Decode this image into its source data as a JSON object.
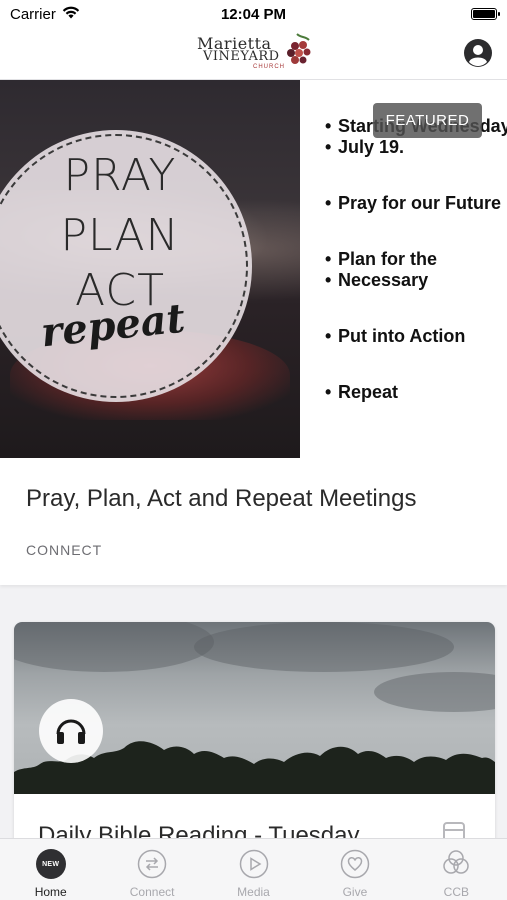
{
  "status_bar": {
    "carrier": "Carrier",
    "time": "12:04 PM"
  },
  "header": {
    "logo_line1": "Marietta",
    "logo_line2": "VINEYARD",
    "logo_line3": "CHURCH",
    "profile_icon": "user-circle-icon"
  },
  "featured": {
    "tag": "FEATURED",
    "image_text": {
      "line1": "PRAY",
      "line2": "PLAN",
      "line3": "ACT",
      "line4": "repeat"
    },
    "bullets": [
      "Starting Wednesday",
      "July 19.",
      "Pray for our Future",
      "Plan for the",
      "Necessary",
      "Put into Action",
      "Repeat"
    ],
    "title": "Pray, Plan, Act and Repeat Meetings",
    "category": "CONNECT"
  },
  "media_card": {
    "icon": "headphones-icon",
    "title": "Daily Bible Reading - Tuesday",
    "side_icon": "document-icon"
  },
  "tab_bar": {
    "tabs": [
      {
        "label": "Home",
        "badge": "NEW",
        "icon": "new-badge-icon",
        "active": true
      },
      {
        "label": "Connect",
        "icon": "arrows-exchange-icon",
        "active": false
      },
      {
        "label": "Media",
        "icon": "play-circle-icon",
        "active": false
      },
      {
        "label": "Give",
        "icon": "heart-circle-icon",
        "active": false
      },
      {
        "label": "CCB",
        "icon": "ccb-circles-icon",
        "active": false
      }
    ]
  },
  "colors": {
    "tab_active": "#222222",
    "tab_inactive": "#a8a8ad",
    "category_text": "#6d6d72",
    "featured_tag_bg": "#505050"
  }
}
